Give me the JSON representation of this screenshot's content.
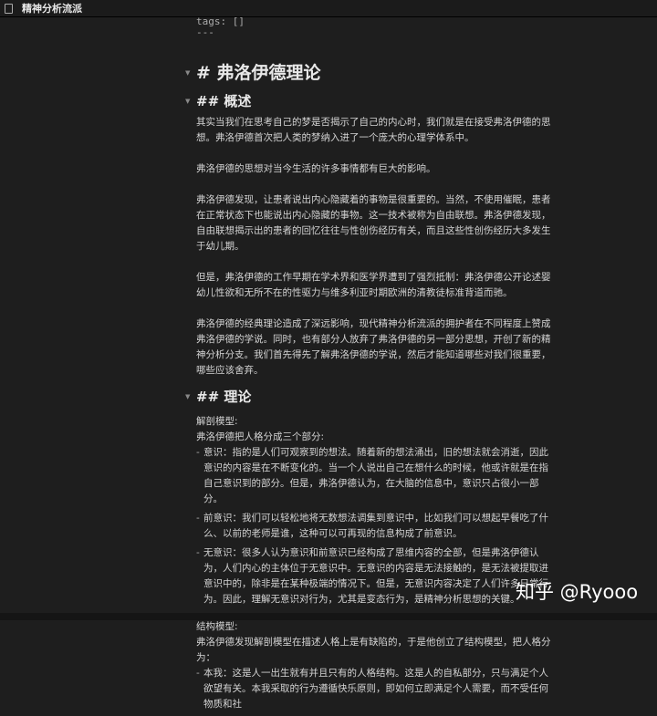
{
  "window": {
    "title": "精神分析流派"
  },
  "frontmatter": {
    "tags": "tags: []",
    "separator": "---"
  },
  "h1": "# 弗洛伊德理论",
  "overview": {
    "heading": "## 概述",
    "paragraphs": [
      "其实当我们在思考自己的梦是否揭示了自己的内心时，我们就是在接受弗洛伊德的思想。弗洛伊德首次把人类的梦纳入进了一个庞大的心理学体系中。",
      "弗洛伊德的思想对当今生活的许多事情都有巨大的影响。",
      "弗洛伊德发现，让患者说出内心隐藏着的事物是很重要的。当然，不使用催眠，患者在正常状态下也能说出内心隐藏的事物。这一技术被称为自由联想。弗洛伊德发现，自由联想揭示出的患者的回忆往往与性创伤经历有关，而且这些性创伤经历大多发生于幼儿期。",
      "但是，弗洛伊德的工作早期在学术界和医学界遭到了强烈抵制：弗洛伊德公开论述婴幼儿性欲和无所不在的性驱力与维多利亚时期欧洲的清教徒标准背道而驰。",
      "弗洛伊德的经典理论造成了深远影响，现代精神分析流派的拥护者在不同程度上赞成弗洛伊德的学说。同时，也有部分人放弃了弗洛伊德的另一部分思想，开创了新的精神分析分支。我们首先得先了解弗洛伊德的学说，然后才能知道哪些对我们很重要，哪些应该舍弃。"
    ]
  },
  "theory": {
    "heading": "## 理论",
    "anatomy_label": "解剖模型:",
    "anatomy_intro": "弗洛伊德把人格分成三个部分:",
    "anatomy_items": [
      "意识：指的是人们可观察到的想法。随着新的想法涌出，旧的想法就会消逝，因此意识的内容是在不断变化的。当一个人说出自己在想什么的时候，他或许就是在指自己意识到的部分。但是，弗洛伊德认为，在大脑的信息中，意识只占很小一部分。",
      "前意识：我们可以轻松地将无数想法调集到意识中，比如我们可以想起早餐吃了什么、以前的老师是谁，这种可以可再现的信息构成了前意识。",
      "无意识：很多人认为意识和前意识已经构成了思维内容的全部，但是弗洛伊德认为，人们内心的主体位于无意识中。无意识的内容是无法接触的，是无法被提取进意识中的，除非是在某种极端的情况下。但是，无意识内容决定了人们许多日常行为。因此，理解无意识对行为，尤其是变态行为，是精神分析思想的关键。"
    ],
    "structure_label": "结构模型:",
    "structure_intro": "弗洛伊德发现解剖模型在描述人格上是有缺陷的，于是他创立了结构模型，把人格分为：",
    "structure_items": [
      "本我：这是人一出生就有并且只有的人格结构。这是人的自私部分，只与满足个人欲望有关。本我采取的行为遵循快乐原则，即如何立即满足个人需要，而不受任何物质和社"
    ]
  },
  "watermark": "知乎 @Ryooo"
}
